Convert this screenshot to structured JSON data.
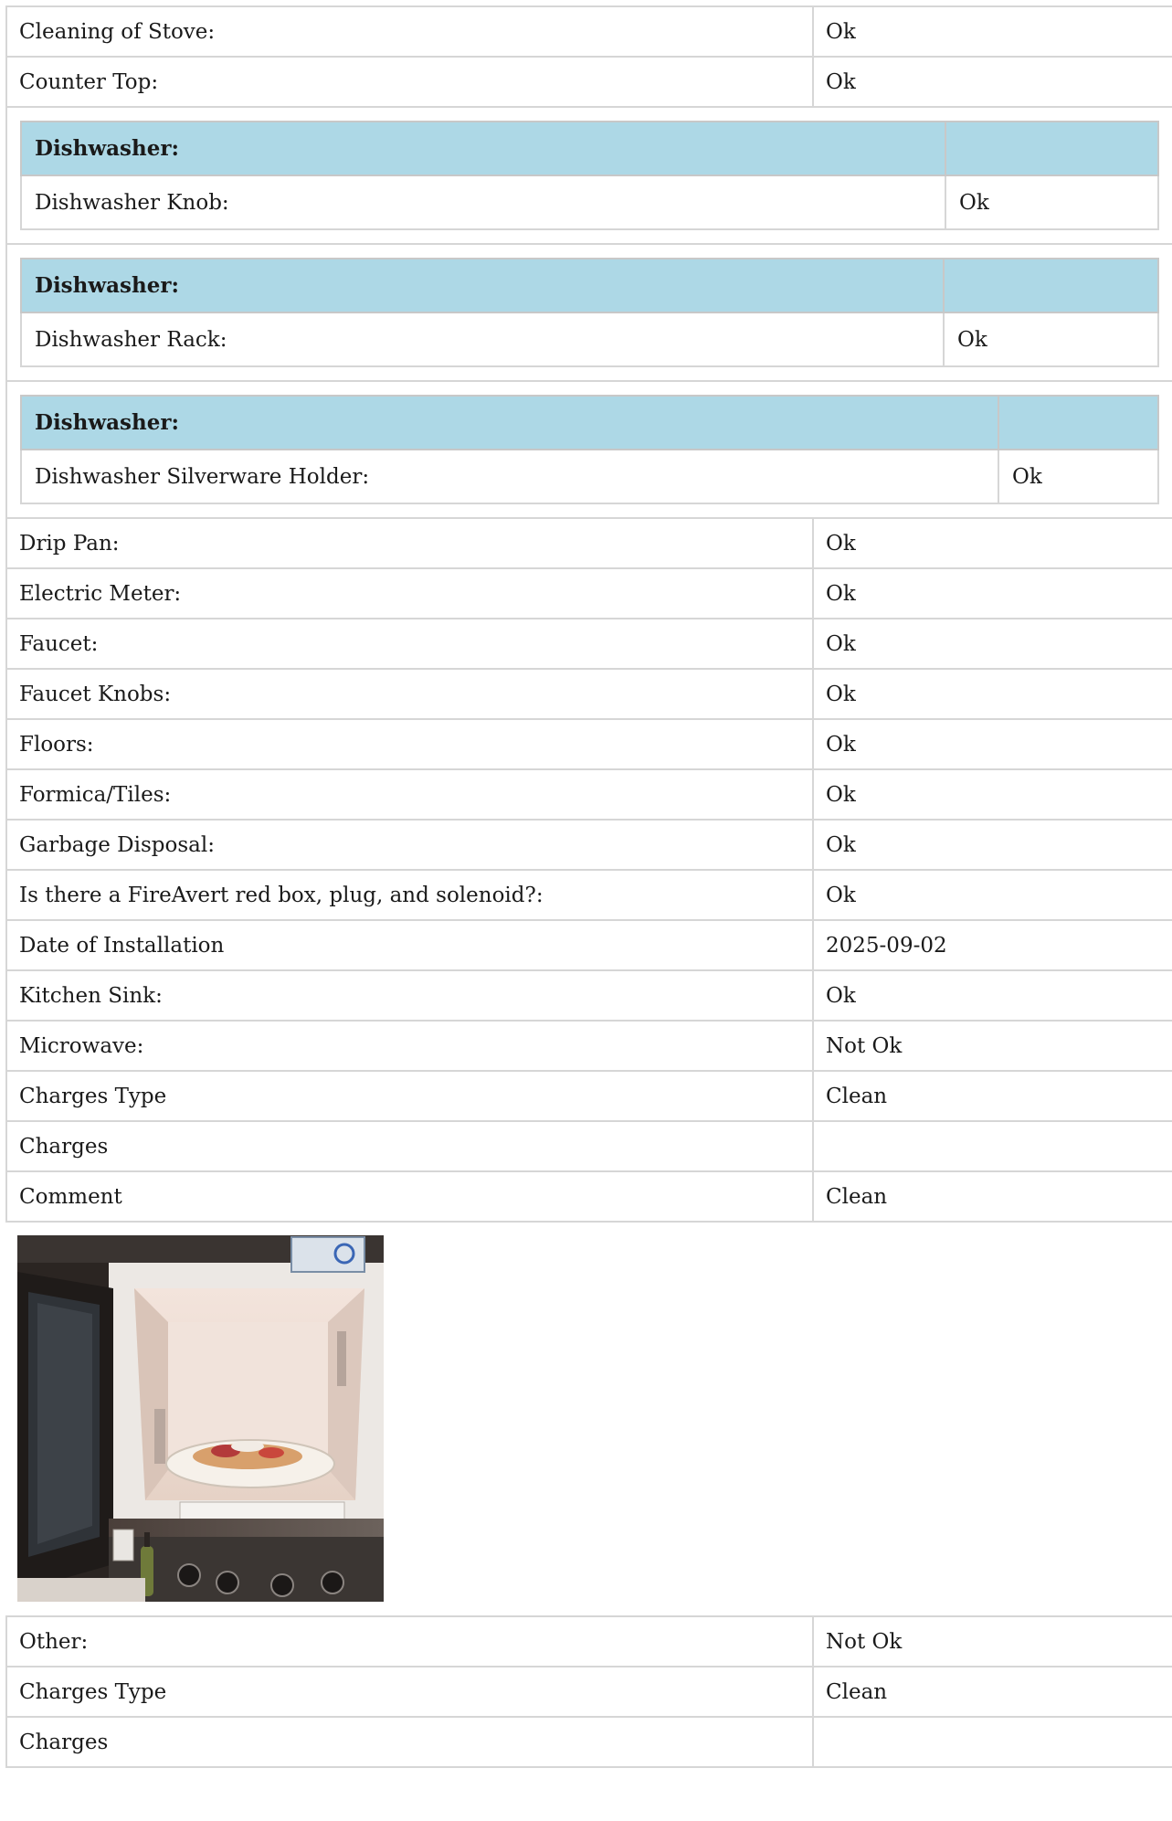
{
  "rows_top": [
    {
      "label": "Cleaning of Stove:",
      "value": "Ok"
    },
    {
      "label": "Counter Top:",
      "value": "Ok"
    }
  ],
  "groups": [
    {
      "header": "Dishwasher:",
      "label": "Dishwasher Knob:",
      "value": "Ok"
    },
    {
      "header": "Dishwasher:",
      "label": "Dishwasher Rack:",
      "value": "Ok"
    },
    {
      "header": "Dishwasher:",
      "label": "Dishwasher Silverware Holder:",
      "value": "Ok"
    }
  ],
  "rows_middle": [
    {
      "label": "Drip Pan:",
      "value": "Ok"
    },
    {
      "label": "Electric Meter:",
      "value": "Ok"
    },
    {
      "label": "Faucet:",
      "value": "Ok"
    },
    {
      "label": "Faucet Knobs:",
      "value": "Ok"
    },
    {
      "label": "Floors:",
      "value": "Ok"
    },
    {
      "label": "Formica/Tiles:",
      "value": "Ok"
    },
    {
      "label": "Garbage Disposal:",
      "value": "Ok"
    },
    {
      "label": "Is there a FireAvert red box, plug, and solenoid?:",
      "value": "Ok"
    },
    {
      "label": "Date of Installation",
      "value": "2025-09-02"
    },
    {
      "label": "Kitchen Sink:",
      "value": "Ok"
    },
    {
      "label": "Microwave:",
      "value": "Not Ok"
    },
    {
      "label": "Charges Type",
      "value": "Clean"
    },
    {
      "label": "Charges",
      "value": ""
    },
    {
      "label": "Comment",
      "value": "Clean"
    }
  ],
  "photo": {
    "subject": "microwave-photo"
  },
  "rows_bottom": [
    {
      "label": "Other:",
      "value": "Not Ok"
    },
    {
      "label": "Charges Type",
      "value": "Clean"
    },
    {
      "label": "Charges",
      "value": ""
    }
  ]
}
